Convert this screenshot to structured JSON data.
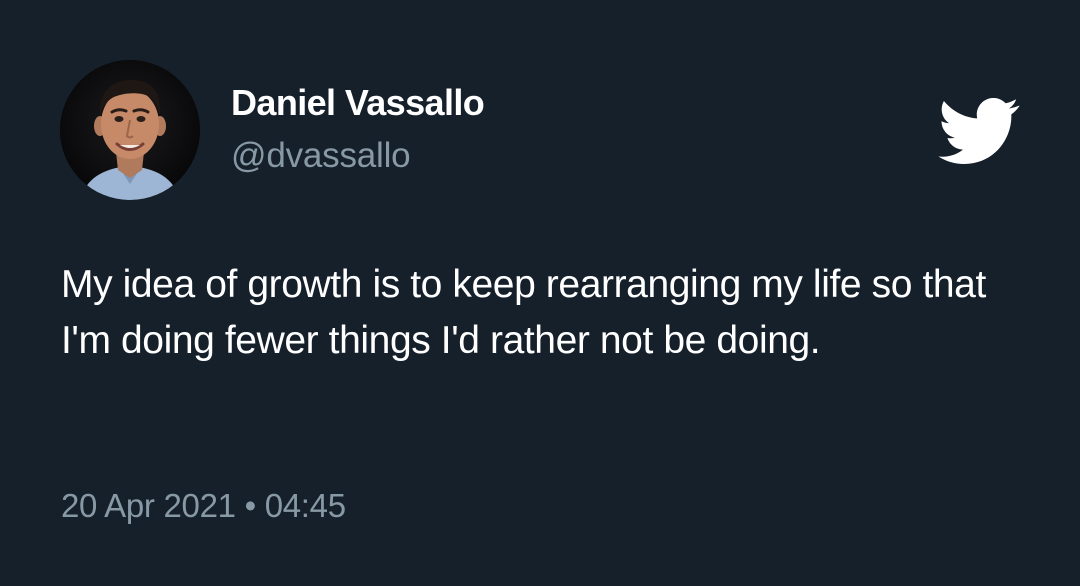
{
  "tweet": {
    "author": {
      "name": "Daniel Vassallo",
      "handle": "@dvassallo",
      "avatar_icon": "profile-photo"
    },
    "text": "My idea of growth is to keep rearranging my life so that I'm doing fewer things I'd rather not be doing.",
    "date": "20 Apr 2021",
    "separator": "•",
    "time": "04:45",
    "brand_icon": "twitter-bird-icon"
  },
  "colors": {
    "background": "#16202b",
    "primary_text": "#ffffff",
    "secondary_text": "#8899a6"
  }
}
